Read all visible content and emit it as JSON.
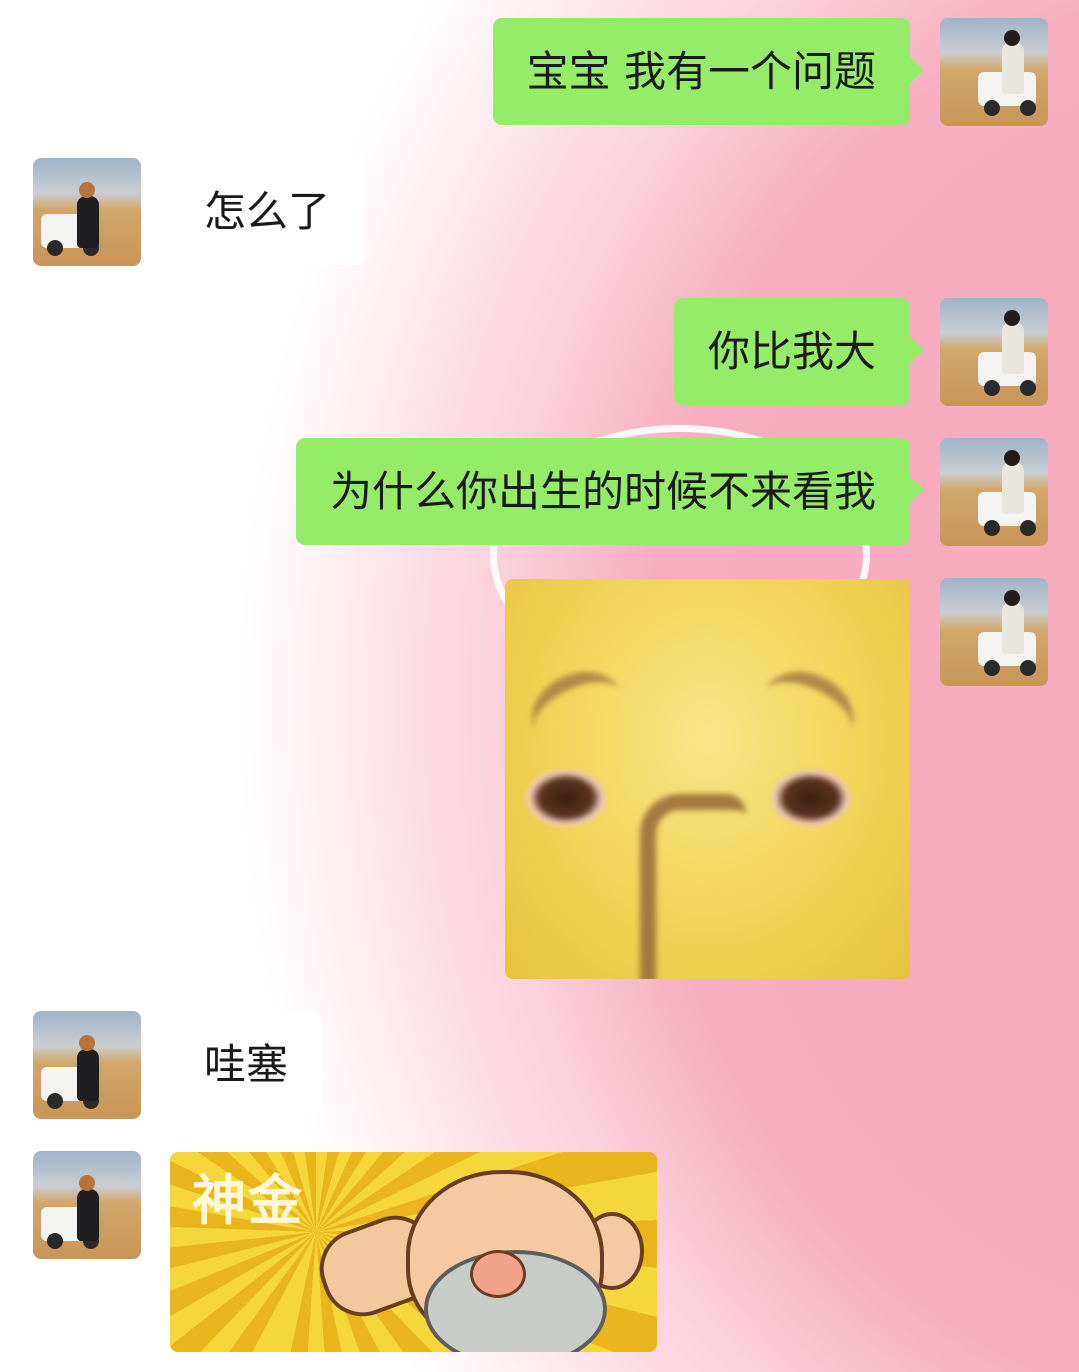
{
  "messages": [
    {
      "side": "right",
      "type": "text",
      "text": "宝宝 我有一个问题"
    },
    {
      "side": "left",
      "type": "text",
      "text": "怎么了"
    },
    {
      "side": "right",
      "type": "text",
      "text": "你比我大"
    },
    {
      "side": "right",
      "type": "text",
      "text": "为什么你出生的时候不来看我"
    },
    {
      "side": "right",
      "type": "sticker",
      "sticker": "pleading-face-sticker"
    },
    {
      "side": "left",
      "type": "text",
      "text": "哇塞"
    },
    {
      "side": "left",
      "type": "sticker",
      "sticker": "god-of-wealth-sticker",
      "text": "神金"
    }
  ],
  "colors": {
    "sent_bubble": "#95ec69",
    "received_bubble": "#ffffff",
    "background": "#f6a9bc"
  }
}
